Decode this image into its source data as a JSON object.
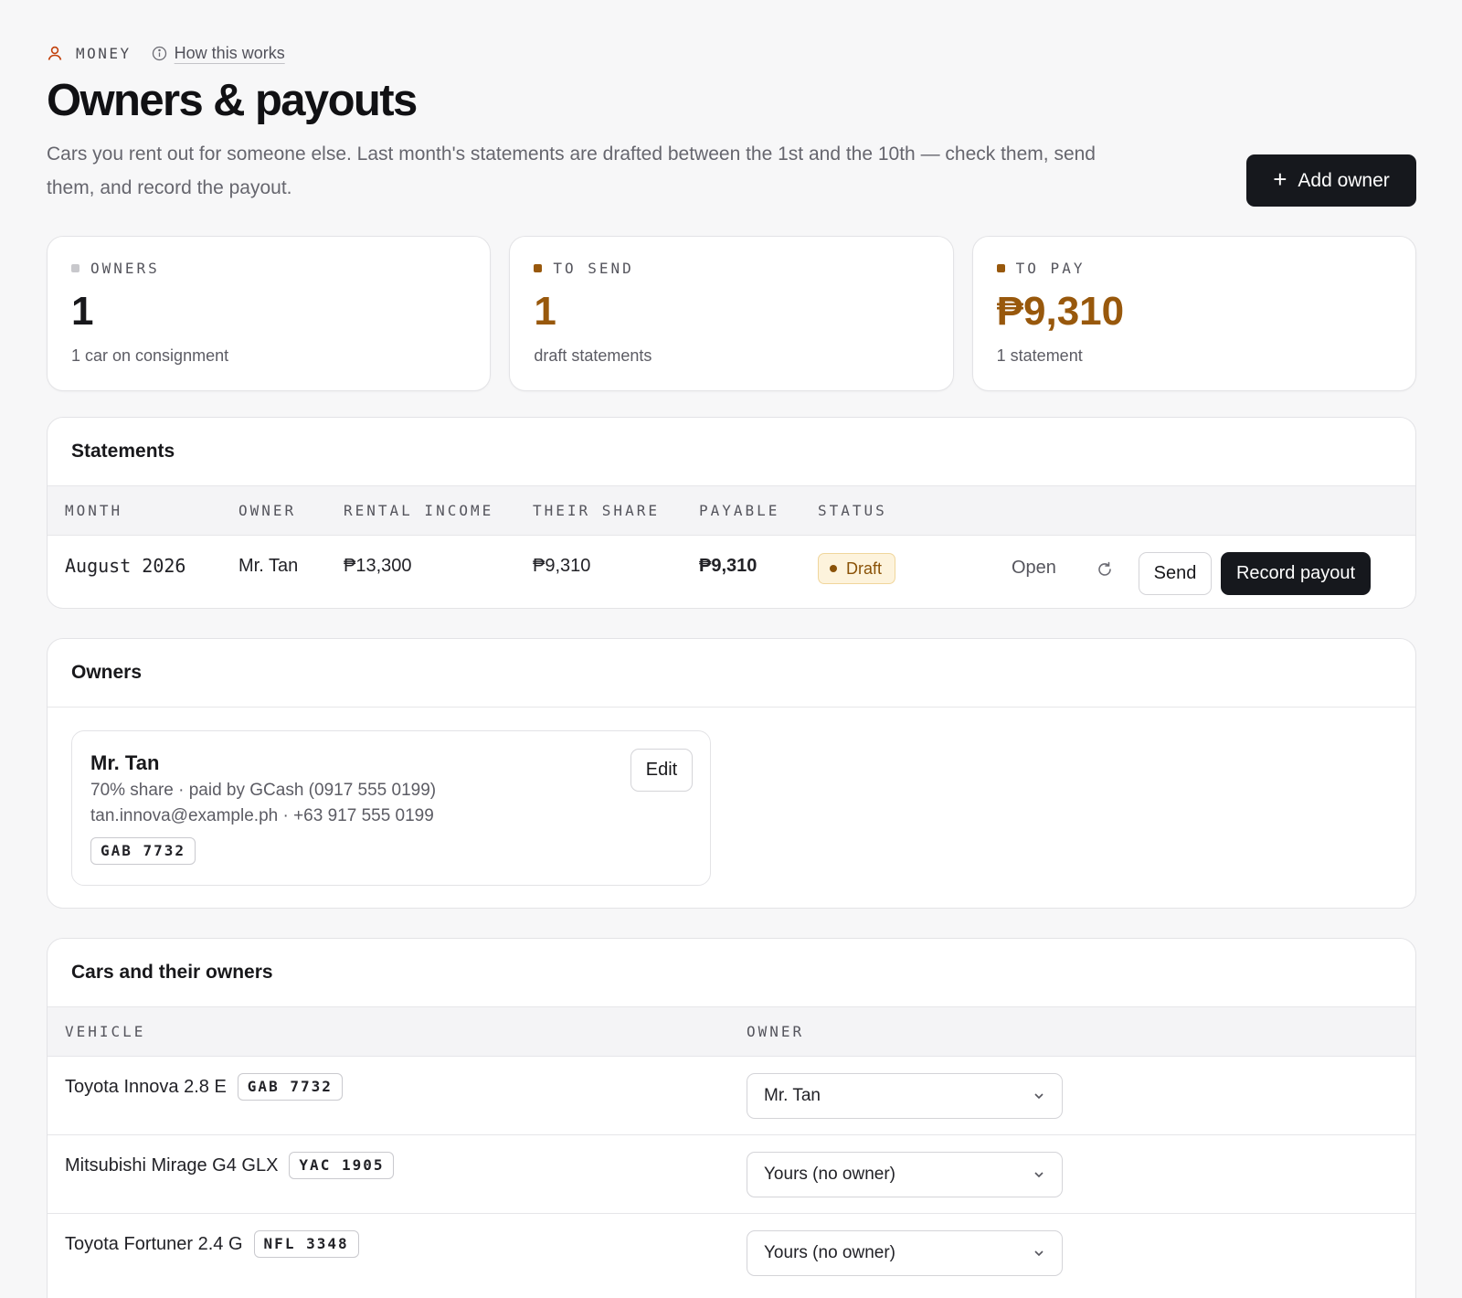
{
  "header": {
    "section": "MONEY",
    "how_link": "How this works",
    "title": "Owners & payouts",
    "subtitle": "Cars you rent out for someone else. Last month's statements are drafted between the 1st and the 10th — check them, send them, and record the payout.",
    "add_owner_label": "Add owner"
  },
  "stats": [
    {
      "label": "OWNERS",
      "value": "1",
      "note": "1 car on consignment",
      "dot_color": "#c8c8cc"
    },
    {
      "label": "TO SEND",
      "value": "1",
      "note": "draft statements",
      "dot_color": "#98580c"
    },
    {
      "label": "TO PAY",
      "value": "₱9,310",
      "note": "1 statement",
      "dot_color": "#98580c"
    }
  ],
  "statements": {
    "title": "Statements",
    "columns": [
      "MONTH",
      "OWNER",
      "RENTAL INCOME",
      "THEIR SHARE",
      "PAYABLE",
      "STATUS"
    ],
    "rows": [
      {
        "month": "August 2026",
        "owner": "Mr. Tan",
        "rental_income": "₱13,300",
        "their_share": "₱9,310",
        "payable": "₱9,310",
        "status": "Draft",
        "open_label": "Open",
        "send_label": "Send",
        "record_label": "Record payout"
      }
    ]
  },
  "owners": {
    "title": "Owners",
    "items": [
      {
        "name": "Mr. Tan",
        "share_line": "70% share · paid by GCash (0917 555 0199)",
        "contact_line": "tan.innova@example.ph · +63 917 555 0199",
        "plate": "GAB 7732",
        "edit_label": "Edit"
      }
    ]
  },
  "cars": {
    "title": "Cars and their owners",
    "columns": [
      "VEHICLE",
      "OWNER"
    ],
    "rows": [
      {
        "vehicle": "Toyota Innova 2.8 E",
        "plate": "GAB 7732",
        "owner": "Mr. Tan"
      },
      {
        "vehicle": "Mitsubishi Mirage G4 GLX",
        "plate": "YAC 1905",
        "owner": "Yours (no owner)"
      },
      {
        "vehicle": "Toyota Fortuner 2.4 G",
        "plate": "NFL 3348",
        "owner": "Yours (no owner)"
      }
    ]
  },
  "colors": {
    "accent": "#98580c",
    "brand_dark": "#16181d",
    "draft_bg": "#fdf3dc",
    "user_icon": "#c2410c"
  },
  "icons": [
    "user-icon",
    "info-icon",
    "plus-icon",
    "refresh-icon",
    "chevron-down-icon"
  ]
}
